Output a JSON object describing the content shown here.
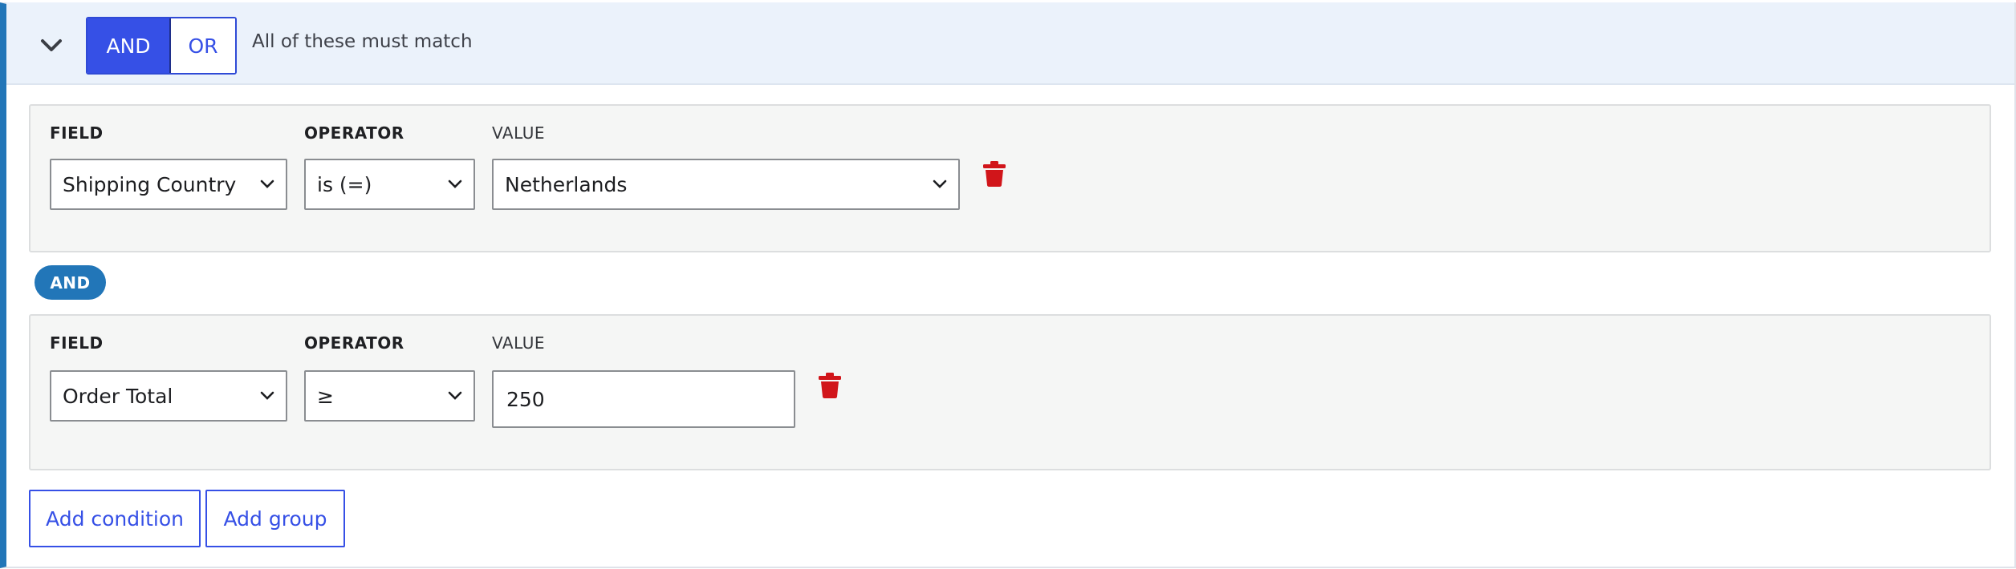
{
  "header": {
    "conjunction_options": [
      "AND",
      "OR"
    ],
    "active_conjunction": "AND",
    "hint": "All of these must match"
  },
  "columns": {
    "field": "FIELD",
    "operator": "OPERATOR",
    "value": "VALUE"
  },
  "conditions": [
    {
      "field": "Shipping Country",
      "operator": "is (=)",
      "value": "Netherlands",
      "value_kind": "select"
    },
    {
      "field": "Order Total",
      "operator": "≥",
      "value": "250",
      "value_kind": "text"
    }
  ],
  "between_label": "AND",
  "actions": {
    "add_condition": "Add condition",
    "add_group": "Add group"
  },
  "colors": {
    "primary": "#3650e6",
    "accent_bar": "#2276b8",
    "delete": "#d1151a",
    "header_bg": "#ebf2fb",
    "row_bg": "#f5f6f5"
  },
  "icons": {
    "collapse": "chevron-down-icon",
    "delete": "trash-icon",
    "select": "chevron-down-icon"
  }
}
